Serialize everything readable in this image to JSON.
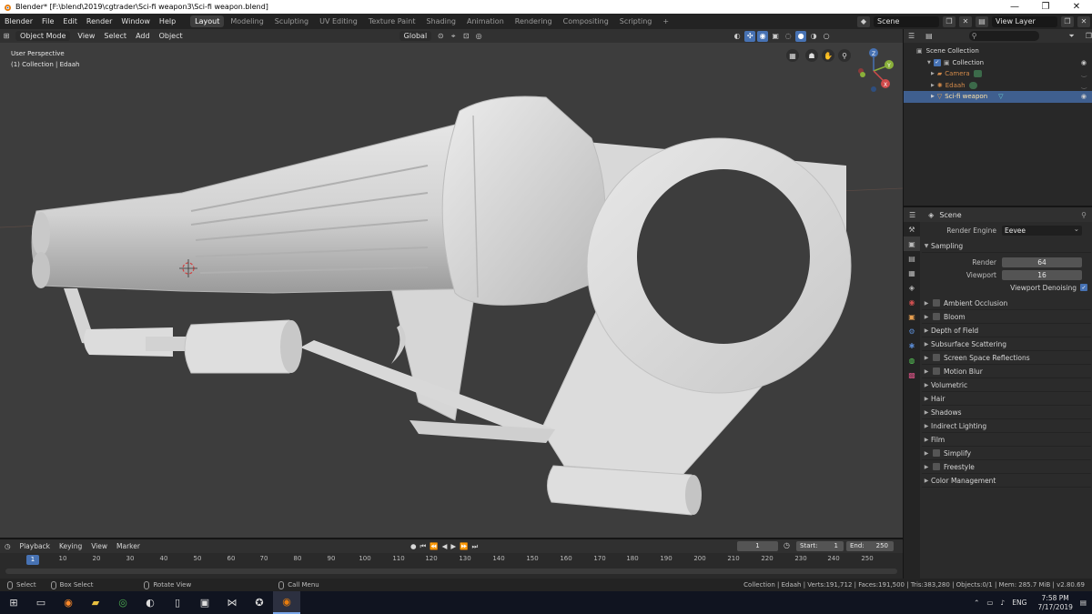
{
  "window": {
    "title": "Blender* [F:\\blend\\2019\\cgtrader\\Sci-fi weapon3\\Sci-fi weapon.blend]",
    "minimize": "—",
    "maximize": "❐",
    "close": "✕"
  },
  "menu": [
    "Blender",
    "File",
    "Edit",
    "Render",
    "Window",
    "Help"
  ],
  "workspaces": [
    "Layout",
    "Modeling",
    "Sculpting",
    "UV Editing",
    "Texture Paint",
    "Shading",
    "Animation",
    "Rendering",
    "Compositing",
    "Scripting"
  ],
  "workspace_add": "+",
  "scene_name": "Scene",
  "view_layer": "View Layer",
  "viewport": {
    "mode": "Object Mode",
    "menus": [
      "View",
      "Select",
      "Add",
      "Object"
    ],
    "orientation": "Global",
    "info_line1": "User Perspective",
    "info_line2": "(1) Collection | Edaah",
    "gizmo_z": "Z",
    "gizmo_y": "Y",
    "gizmo_x": "X"
  },
  "outliner": {
    "rows": [
      {
        "label": "Scene Collection",
        "indent": 0
      },
      {
        "label": "Collection",
        "indent": 1
      },
      {
        "label": "Camera",
        "indent": 2
      },
      {
        "label": "Edaah",
        "indent": 2
      },
      {
        "label": "Sci-fi weapon",
        "indent": 2
      }
    ]
  },
  "properties": {
    "context": "Scene",
    "render_engine_label": "Render Engine",
    "render_engine": "Eevee",
    "sampling": "Sampling",
    "render_label": "Render",
    "render_samples": "64",
    "viewport_label": "Viewport",
    "viewport_samples": "16",
    "viewport_denoising": "Viewport Denoising",
    "panels": [
      {
        "label": "Ambient Occlusion",
        "checkbox": true
      },
      {
        "label": "Bloom",
        "checkbox": true
      },
      {
        "label": "Depth of Field",
        "checkbox": false
      },
      {
        "label": "Subsurface Scattering",
        "checkbox": false
      },
      {
        "label": "Screen Space Reflections",
        "checkbox": true
      },
      {
        "label": "Motion Blur",
        "checkbox": true
      },
      {
        "label": "Volumetric",
        "checkbox": false
      },
      {
        "label": "Hair",
        "checkbox": false
      },
      {
        "label": "Shadows",
        "checkbox": false
      },
      {
        "label": "Indirect Lighting",
        "checkbox": false
      },
      {
        "label": "Film",
        "checkbox": false
      },
      {
        "label": "Simplify",
        "checkbox": true
      },
      {
        "label": "Freestyle",
        "checkbox": true
      },
      {
        "label": "Color Management",
        "checkbox": false
      }
    ]
  },
  "timeline": {
    "menus": [
      "Playback",
      "Keying",
      "View",
      "Marker"
    ],
    "current_frame": "1",
    "start_label": "Start:",
    "start": "1",
    "end_label": "End:",
    "end": "250",
    "ticks": [
      "10",
      "20",
      "30",
      "40",
      "50",
      "60",
      "70",
      "80",
      "90",
      "100",
      "110",
      "120",
      "130",
      "140",
      "150",
      "160",
      "170",
      "180",
      "190",
      "200",
      "210",
      "220",
      "230",
      "240",
      "250"
    ],
    "ruler_current": "1"
  },
  "status": {
    "select": "Select",
    "box_select": "Box Select",
    "rotate_view": "Rotate View",
    "call_menu": "Call Menu",
    "stats": "Collection | Edaah | Verts:191,712 | Faces:191,500 | Tris:383,280 | Objects:0/1 | Mem: 285.7 MiB | v2.80.69"
  },
  "taskbar": {
    "lang": "ENG",
    "time": "7:58 PM",
    "date": "7/17/2019"
  }
}
